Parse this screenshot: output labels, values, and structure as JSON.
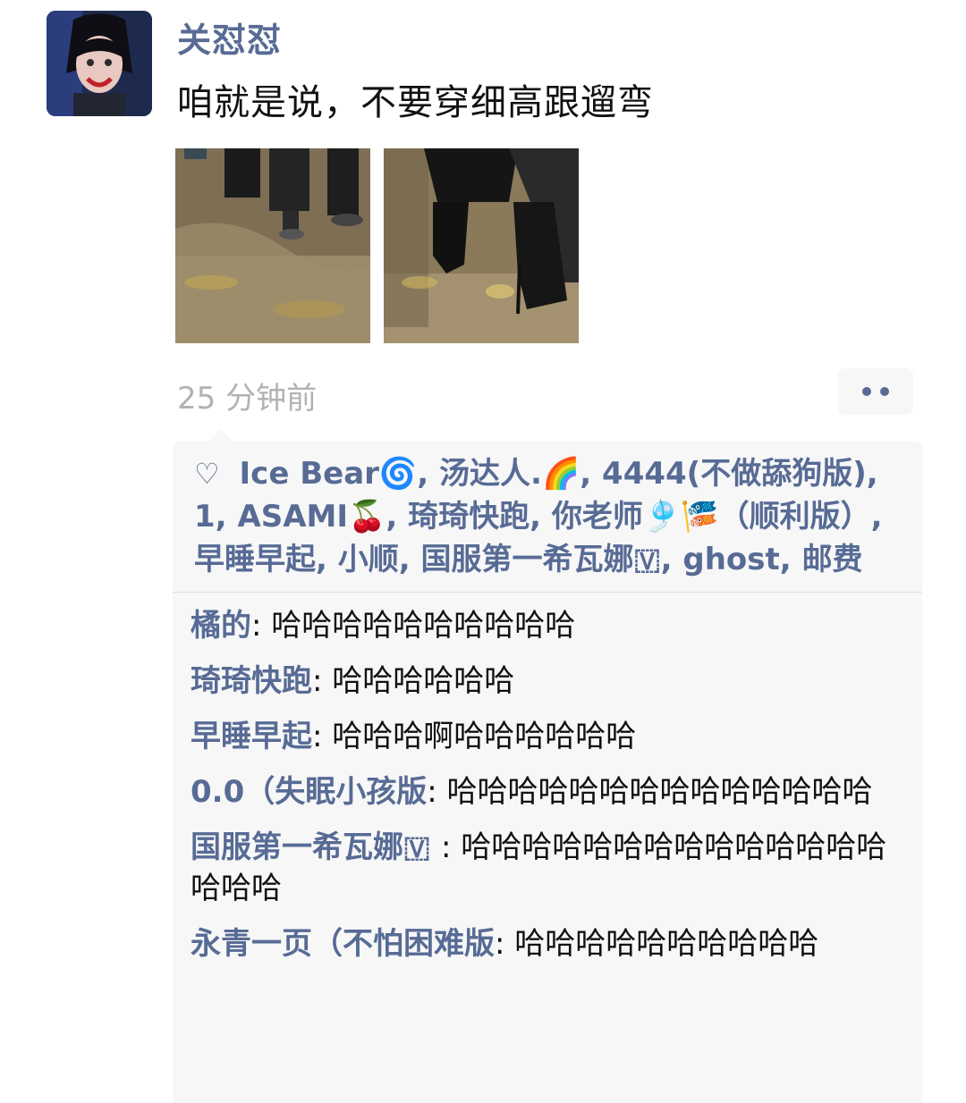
{
  "post": {
    "author": "关怼怼",
    "text": "咱就是说，不要穿细高跟遛弯",
    "time": "25 分钟前"
  },
  "likes": {
    "names": [
      "Ice Bear🌀",
      "汤达人.🌈",
      "4444(不做舔狗版)",
      "1",
      "ASAMI🍒",
      "琦琦快跑",
      "你老师🎐🎏（顺利版）",
      "早睡早起",
      "小顺",
      "国服第一希瓦娜🇻",
      "ghost",
      "邮费"
    ]
  },
  "comments": [
    {
      "user": "橘的",
      "text": "哈哈哈哈哈哈哈哈哈哈"
    },
    {
      "user": "琦琦快跑",
      "text": "哈哈哈哈哈哈"
    },
    {
      "user": "早睡早起",
      "text": "哈哈哈啊哈哈哈哈哈哈"
    },
    {
      "user": "0.0（失眠小孩版",
      "text": "哈哈哈哈哈哈哈哈哈哈哈哈哈哈"
    },
    {
      "user": "国服第一希瓦娜🇻 ",
      "text": "哈哈哈哈哈哈哈哈哈哈哈哈哈哈哈哈哈"
    },
    {
      "user": "永青一页（不怕困难版",
      "text": "哈哈哈哈哈哈哈哈哈哈"
    }
  ],
  "colors": {
    "link": "#576b95",
    "text": "#111111",
    "muted": "#b2b2b2",
    "panel": "#f7f7f7"
  },
  "icons": {
    "like": "heart-outline-icon",
    "more": "two-dots-icon"
  }
}
